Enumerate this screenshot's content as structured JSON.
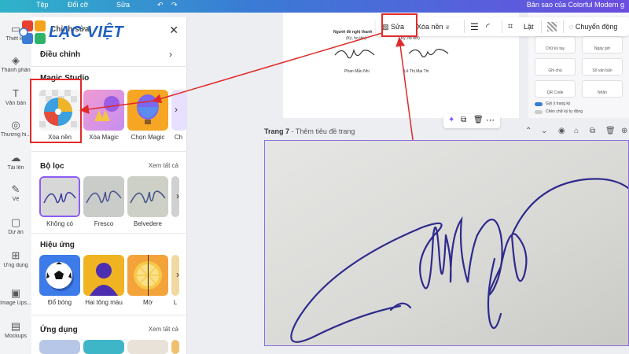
{
  "topbar": {
    "items": [
      "Tệp",
      "Đổi cỡ",
      "Sửa"
    ],
    "doc_title": "Bản sao của Colorful Modern g"
  },
  "brand": {
    "name": "LẠC VIỆT"
  },
  "rail": {
    "items": [
      {
        "label": "Thiết kế",
        "icon": "layout-icon"
      },
      {
        "label": "Thành phần",
        "icon": "shapes-icon"
      },
      {
        "label": "Văn bản",
        "icon": "text-icon"
      },
      {
        "label": "Thương hi...",
        "icon": "brand-icon"
      },
      {
        "label": "Tải lên",
        "icon": "upload-icon"
      },
      {
        "label": "Vẽ",
        "icon": "draw-icon"
      },
      {
        "label": "Dự án",
        "icon": "folder-icon"
      },
      {
        "label": "Ứng dụng",
        "icon": "apps-icon"
      },
      {
        "label": "Image Ups...",
        "icon": "image-upscaler-icon"
      },
      {
        "label": "Mockups",
        "icon": "mockups-icon"
      }
    ]
  },
  "panel": {
    "title": "Chỉnh sửa",
    "adjust": "Điều chỉnh",
    "magic_studio": "Magic Studio",
    "magic_items": [
      "Xóa nền",
      "Xóa Magic",
      "Chọn Magic",
      "Ch"
    ],
    "filters_title": "Bộ lọc",
    "filters_see_all": "Xem tất cả",
    "filters": [
      "Không có",
      "Fresco",
      "Belvedere"
    ],
    "effects_title": "Hiệu ứng",
    "effects": [
      "Đổ bóng",
      "Hai tông màu",
      "Mờ",
      "L"
    ],
    "apps_title": "Ứng dụng",
    "apps_see_all": "Xem tất cả"
  },
  "toolbar": {
    "edit": "Sửa",
    "remove_bg": "Xóa nền",
    "flip": "Lật",
    "animate": "Chuyển động"
  },
  "page_top": {
    "signer_label": "Người đề nghị thanh",
    "name_1": "Phan Mẫn Nhi",
    "name_2": "Lê Thị Mai Thi",
    "role_1": "(Ký, họ tên)",
    "role_2": "(Ký, họ tên)"
  },
  "right_panel": {
    "cards": [
      "Chữ ký tay",
      "Ngày giờ",
      "Ghi chú",
      "Số văn bản",
      "QR Code",
      "Nhãn"
    ],
    "toggles": [
      "Gửi ý trang ký",
      "Chèn chữ ký tự động"
    ]
  },
  "page": {
    "number": "Trang 7",
    "title_placeholder": "Thêm tiêu đề trang"
  },
  "colors": {
    "highlight": "#e12a2a",
    "selection": "#8a6ee0",
    "brand": "#1f5fbf"
  }
}
